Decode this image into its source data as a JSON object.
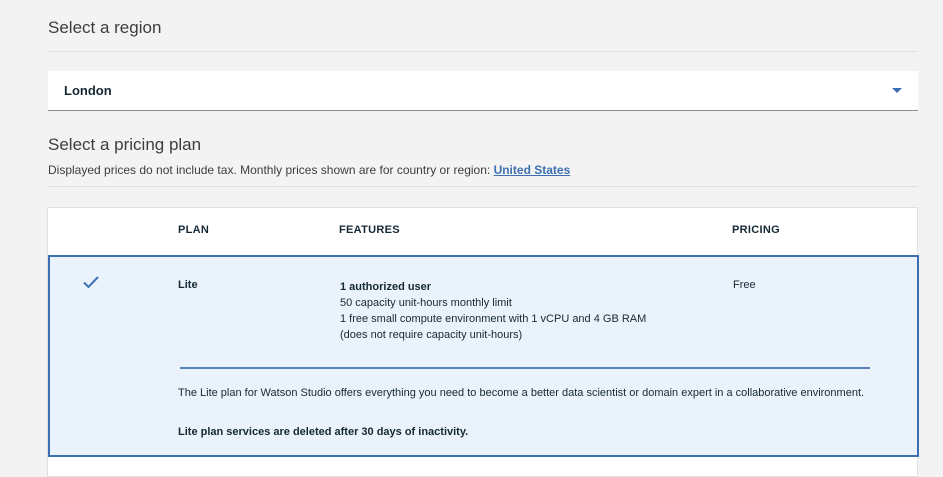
{
  "region": {
    "heading": "Select a region",
    "selected": "London"
  },
  "pricing": {
    "heading": "Select a pricing plan",
    "disclaimer": "Displayed prices do not include tax. Monthly prices shown are for country or region: ",
    "country_link": "United States"
  },
  "table": {
    "headers": {
      "plan": "PLAN",
      "features": "FEATURES",
      "pricing": "PRICING"
    },
    "plans": [
      {
        "name": "Lite",
        "selected": true,
        "features": [
          "1 authorized user",
          "50 capacity unit-hours monthly limit",
          "1 free small compute environment with 1 vCPU and 4 GB RAM",
          "(does not require capacity unit-hours)"
        ],
        "price": "Free",
        "description": "The Lite plan for Watson Studio offers everything you need to become a better data scientist or domain expert in a collaborative environment.",
        "notice": "Lite plan services are deleted after 30 days of inactivity."
      }
    ]
  },
  "colors": {
    "accent": "#3d70b2",
    "selected_row_bg": "#eaf2fb",
    "page_bg": "#f3f3f3"
  },
  "icons": {
    "select_caret": "chevron-down-icon",
    "selected_check": "checkmark-icon"
  }
}
